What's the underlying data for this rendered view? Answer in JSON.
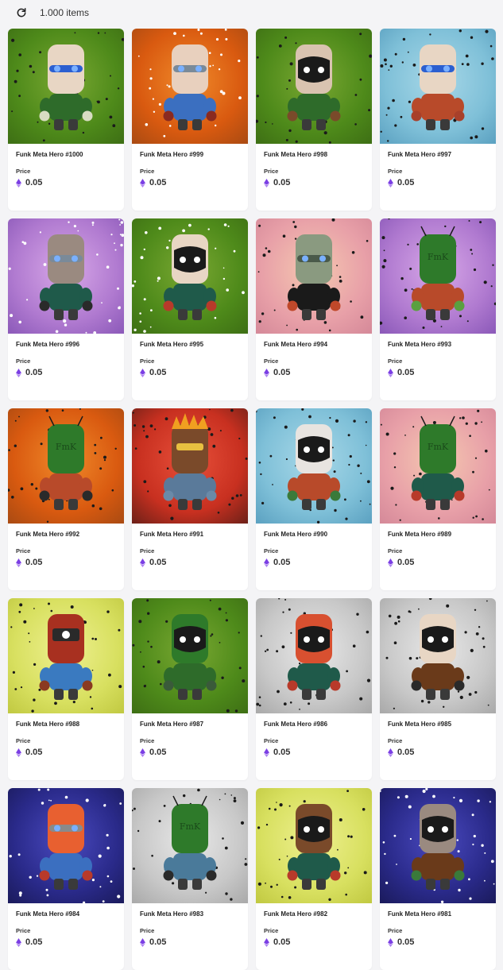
{
  "header": {
    "count_label": "1.000 items",
    "refresh_icon": "refresh-icon"
  },
  "items": [
    {
      "name": "Funk Meta Hero #1000",
      "price_label": "Price",
      "price": "0.05",
      "bg": [
        "#4e8a1a",
        "#7aa832",
        "#3d6e14"
      ],
      "dots": "#1a1a1a",
      "head": "#e8d6c4",
      "band": "#2b5fd0",
      "body": "#2e6b2a",
      "hands": "#d8dcc2",
      "mask": "none"
    },
    {
      "name": "Funk Meta Hero #999",
      "price_label": "Price",
      "price": "0.05",
      "bg": [
        "#d95a10",
        "#f08a2a",
        "#a84a12"
      ],
      "dots": "#ffffff",
      "head": "#e8d0be",
      "band": "#7a8a99",
      "body": "#3b6fc0",
      "hands": "#8a2a20",
      "mask": "none"
    },
    {
      "name": "Funk Meta Hero #998",
      "price_label": "Price",
      "price": "0.05",
      "bg": [
        "#4e8a1a",
        "#7aa832",
        "#3d6e14"
      ],
      "dots": "#1a1a1a",
      "head": "#d9c3b0",
      "band": "#1a1a1a",
      "body": "#2e6b2a",
      "hands": "#7a4a2a",
      "mask": "dark"
    },
    {
      "name": "Funk Meta Hero #997",
      "price_label": "Price",
      "price": "0.05",
      "bg": [
        "#7fc0d8",
        "#a8d8e8",
        "#5aa0c0"
      ],
      "dots": "#1a1a1a",
      "head": "#e8d6c4",
      "band": "#2b5fd0",
      "body": "#b84a2a",
      "hands": "#a8402a",
      "mask": "none"
    },
    {
      "name": "Funk Meta Hero #996",
      "price_label": "Price",
      "price": "0.05",
      "bg": [
        "#b07ad0",
        "#d8a8e8",
        "#8a58b8"
      ],
      "dots": "#ffffff",
      "head": "#9a8a80",
      "band": "#7a8a99",
      "body": "#1f5a4a",
      "hands": "#2a2a2a",
      "mask": "none"
    },
    {
      "name": "Funk Meta Hero #995",
      "price_label": "Price",
      "price": "0.05",
      "bg": [
        "#4e8a1a",
        "#7aa832",
        "#3d6e14"
      ],
      "dots": "#ffffff",
      "head": "#e8d6c4",
      "band": "#1a1a1a",
      "body": "#1f5a4a",
      "hands": "#b83a2a",
      "mask": "dark"
    },
    {
      "name": "Funk Meta Hero #994",
      "price_label": "Price",
      "price": "0.05",
      "bg": [
        "#e8a0a8",
        "#f5c8b0",
        "#d48898"
      ],
      "dots": "#1a1a1a",
      "head": "#8a9a80",
      "band": "#4a5a4a",
      "body": "#1a1a1a",
      "hands": "#c0482a",
      "mask": "none"
    },
    {
      "name": "Funk Meta Hero #993",
      "price_label": "Price",
      "price": "0.05",
      "bg": [
        "#b07ad0",
        "#d8a8e8",
        "#8a58b8"
      ],
      "dots": "#1a1a1a",
      "head": "#2e7a2a",
      "band": "#2e7a2a",
      "body": "#b84a2a",
      "hands": "#5aa040",
      "mask": "ant"
    },
    {
      "name": "Funk Meta Hero #992",
      "price_label": "Price",
      "price": "0.05",
      "bg": [
        "#d95a10",
        "#f08a2a",
        "#a84a12"
      ],
      "dots": "#1a1a1a",
      "head": "#2e7a2a",
      "band": "#2e7a2a",
      "body": "#b84a2a",
      "hands": "#2a2a2a",
      "mask": "ant"
    },
    {
      "name": "Funk Meta Hero #991",
      "price_label": "Price",
      "price": "0.05",
      "bg": [
        "#c83020",
        "#e8503a",
        "#6a2018"
      ],
      "dots": "#1a1a1a",
      "head": "#7a4a2a",
      "band": "#e8c040",
      "body": "#5a7a9a",
      "hands": "#6a8aa8",
      "mask": "fire"
    },
    {
      "name": "Funk Meta Hero #990",
      "price_label": "Price",
      "price": "0.05",
      "bg": [
        "#7fc0d8",
        "#a8d8e8",
        "#5aa0c0"
      ],
      "dots": "#1a1a1a",
      "head": "#e8e4e0",
      "band": "#1a1a1a",
      "body": "#b84a2a",
      "hands": "#3a7a3a",
      "mask": "dark"
    },
    {
      "name": "Funk Meta Hero #989",
      "price_label": "Price",
      "price": "0.05",
      "bg": [
        "#e8a0a8",
        "#f5c8b0",
        "#d48898"
      ],
      "dots": "#1a1a1a",
      "head": "#2e7a2a",
      "band": "#2e7a2a",
      "body": "#1f5a4a",
      "hands": "#b83a2a",
      "mask": "ant"
    },
    {
      "name": "Funk Meta Hero #988",
      "price_label": "Price",
      "price": "0.05",
      "bg": [
        "#d8e060",
        "#eef090",
        "#c0c840"
      ],
      "dots": "#1a1a1a",
      "head": "#a83020",
      "band": "#e8c040",
      "body": "#3a7ac0",
      "hands": "#8a3a20",
      "mask": "helmet"
    },
    {
      "name": "Funk Meta Hero #987",
      "price_label": "Price",
      "price": "0.05",
      "bg": [
        "#4e8a1a",
        "#7aa832",
        "#3d6e14"
      ],
      "dots": "#1a1a1a",
      "head": "#2e7a2a",
      "band": "#1a1a1a",
      "body": "#2e6b2a",
      "hands": "#3a5a3a",
      "mask": "dark"
    },
    {
      "name": "Funk Meta Hero #986",
      "price_label": "Price",
      "price": "0.05",
      "bg": [
        "#c8c8c8",
        "#e8e8e8",
        "#a8a8a8"
      ],
      "dots": "#1a1a1a",
      "head": "#d85030",
      "band": "#1a1a1a",
      "body": "#1f5a4a",
      "hands": "#b83a2a",
      "mask": "dark"
    },
    {
      "name": "Funk Meta Hero #985",
      "price_label": "Price",
      "price": "0.05",
      "bg": [
        "#c8c8c8",
        "#e8e8e8",
        "#a8a8a8"
      ],
      "dots": "#1a1a1a",
      "head": "#e8d6c4",
      "band": "#1a1a1a",
      "body": "#6a3a1a",
      "hands": "#2a2a2a",
      "mask": "dark"
    },
    {
      "name": "Funk Meta Hero #984",
      "price_label": "Price",
      "price": "0.05",
      "bg": [
        "#2a2a8a",
        "#4a4ac0",
        "#1a1a5a"
      ],
      "dots": "#ffffff",
      "head": "#e86030",
      "band": "#8a8a8a",
      "body": "#3b6fc0",
      "hands": "#b83a2a",
      "mask": "none"
    },
    {
      "name": "Funk Meta Hero #983",
      "price_label": "Price",
      "price": "0.05",
      "bg": [
        "#c8c8c8",
        "#e8e8e8",
        "#a8a8a8"
      ],
      "dots": "#1a1a1a",
      "head": "#2e7a2a",
      "band": "#2e7a2a",
      "body": "#4a7a9a",
      "hands": "#2a2a2a",
      "mask": "ant"
    },
    {
      "name": "Funk Meta Hero #982",
      "price_label": "Price",
      "price": "0.05",
      "bg": [
        "#d8e060",
        "#eef090",
        "#c0c840"
      ],
      "dots": "#1a1a1a",
      "head": "#7a4a2a",
      "band": "#1a1a1a",
      "body": "#1f5a4a",
      "hands": "#b83a2a",
      "mask": "dark"
    },
    {
      "name": "Funk Meta Hero #981",
      "price_label": "Price",
      "price": "0.05",
      "bg": [
        "#2a2a8a",
        "#4a4ac0",
        "#1a1a5a"
      ],
      "dots": "#ffffff",
      "head": "#9a8a80",
      "band": "#1a1a1a",
      "body": "#6a3a1a",
      "hands": "#3a7a3a",
      "mask": "dark"
    }
  ],
  "colors": {
    "page_bg": "#f4f4f6",
    "card_bg": "#ffffff",
    "eth_icon": "#7b3fe4"
  }
}
